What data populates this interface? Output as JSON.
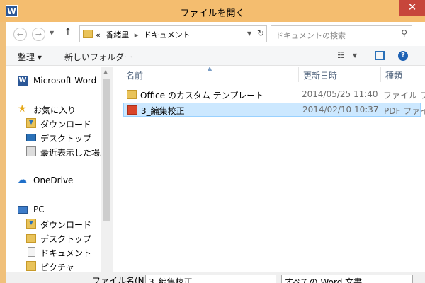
{
  "window": {
    "title": "ファイルを開く",
    "app_icon": "word-icon",
    "close_label": "✕"
  },
  "nav": {
    "back_icon": "back-arrow-icon",
    "forward_icon": "forward-arrow-icon",
    "up_icon": "up-arrow-icon",
    "address_prefix": "«",
    "address_parts": [
      "香緒里",
      "ドキュメント"
    ],
    "search_placeholder": "ドキュメントの検索"
  },
  "toolbar": {
    "organize_label": "整理 ▾",
    "new_folder_label": "新しいフォルダー"
  },
  "sidebar": {
    "items": [
      {
        "label": "Microsoft Word",
        "icon": "word-icon"
      },
      {
        "label": "お気に入り",
        "icon": "star-icon"
      },
      {
        "label": "ダウンロード",
        "icon": "download-folder-icon"
      },
      {
        "label": "デスクトップ",
        "icon": "desktop-icon"
      },
      {
        "label": "最近表示した場所",
        "icon": "recent-places-icon"
      },
      {
        "label": "OneDrive",
        "icon": "cloud-icon"
      },
      {
        "label": "PC",
        "icon": "pc-icon"
      },
      {
        "label": "ダウンロード",
        "icon": "download-folder-icon"
      },
      {
        "label": "デスクトップ",
        "icon": "desktop-folder-icon"
      },
      {
        "label": "ドキュメント",
        "icon": "documents-folder-icon"
      },
      {
        "label": "ピクチャ",
        "icon": "pictures-folder-icon"
      }
    ]
  },
  "files": {
    "columns": [
      "名前",
      "更新日時",
      "種類"
    ],
    "rows": [
      {
        "name": "Office のカスタム テンプレート",
        "date": "2014/05/25 11:40",
        "type": "ファイル フォ",
        "icon": "folder-icon",
        "selected": false
      },
      {
        "name": "3_編集校正",
        "date": "2014/02/10 10:37",
        "type": "PDF ファイ",
        "icon": "pdf-icon",
        "selected": true
      }
    ]
  },
  "bottom": {
    "filename_label": "ファイル名(N):",
    "filename_value": "3_編集校正",
    "filetype_value": "すべての Word 文書"
  }
}
